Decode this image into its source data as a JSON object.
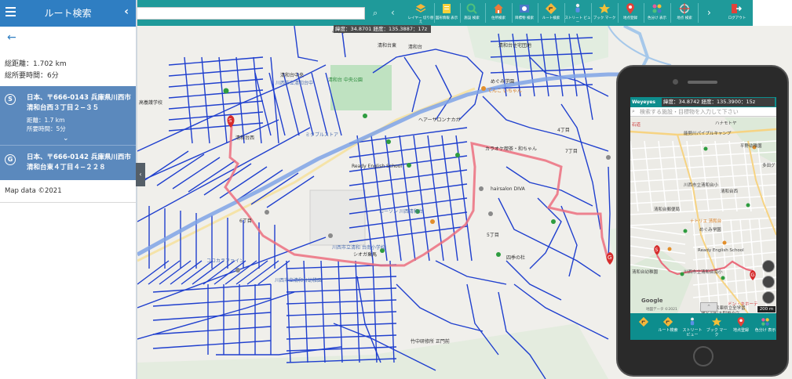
{
  "panel": {
    "title": "ルート検索",
    "summary": {
      "distance": "総距離：1.702 km",
      "duration": "総所要時間：6分"
    },
    "start": {
      "badge": "S",
      "address": "日本、〒666-0143 兵庫県川西市清和台西３丁目２−３５",
      "distance": "距離：1.7 km",
      "duration": "所要時間：5分"
    },
    "goal": {
      "badge": "G",
      "address": "日本、〒666-0142 兵庫県川西市清和台東４丁目４−２２８"
    },
    "map_data": "Map data ©2021"
  },
  "toolbar": {
    "search_placeholder": "",
    "buttons": [
      {
        "label": "レイヤー 切り替え",
        "icon": "layers-icon",
        "color": "#f4b63a"
      },
      {
        "label": "図形情報 表示",
        "icon": "note-icon",
        "color": "#f7d13c"
      },
      {
        "label": "施設 検索",
        "icon": "magnifier-icon",
        "color": "#4fc07c"
      },
      {
        "label": "住所検索",
        "icon": "house-icon",
        "color": "#ee7a3a"
      },
      {
        "label": "目標物 検索",
        "icon": "target-icon",
        "color": "#4b78c9"
      },
      {
        "label": "ルート検索",
        "icon": "route-sign-icon",
        "color": "#f4b63a"
      },
      {
        "label": "ストリート ビュー",
        "icon": "person-icon",
        "color": "#eeeeee"
      },
      {
        "label": "ブック マーク",
        "icon": "star-icon",
        "color": "#f4c037"
      },
      {
        "label": "地点登録",
        "icon": "pin-icon",
        "color": "#e0423a"
      },
      {
        "label": "色分け 表示",
        "icon": "colors-icon",
        "color": "#e85b9c"
      },
      {
        "label": "地点 検索",
        "icon": "crosshair-icon",
        "color": "#666666"
      },
      {
        "label": "ログアウト",
        "icon": "logout-icon",
        "color": "#e0423a"
      }
    ]
  },
  "map": {
    "coords": "緯度：34.8701 経度：135.3887：17z",
    "labels": {
      "park": "清和台 中央公園",
      "area1": "清和台東",
      "area2": "清和台西",
      "facility1": "清和台住宅団地",
      "facility2": "めぐみ学園",
      "school1": "川西市立清和 台南小学校",
      "school2": "川西市立清和台中",
      "shop1": "カラオケ喫茶・和ちゃん",
      "shop2": "ヘアーサロンナカガ",
      "shop3": "hairsalon DIVA",
      "shop4": "Ready English School",
      "chome1": "4丁目",
      "chome2": "5丁目",
      "chome3": "6丁目",
      "chome4": "7丁目",
      "road": "清和台",
      "lawson": "ローソン 川西清和台",
      "shiga": "シオガ乗馬",
      "kindergarten": "川西市立清和台幼稚園",
      "station": "竹中研修所 正門前",
      "estate": "四季の杜",
      "gokk": "ココカラファイン",
      "mitsu": "ミタブルストア",
      "pharmacy": "みやび",
      "gakko": "高養護学校",
      "tenko": "てんこ いちゃん",
      "chuo": "清和台中央"
    }
  },
  "phone": {
    "logo": "Weyeyes",
    "coords": "緯度：34.8742 経度：135.3900：15z",
    "search_placeholder": "検索する施設・目標物を入力して下さい",
    "labels": {
      "shop": "ハナモトヤ",
      "pipe": "能勢川パイプルキャンプ",
      "hirano": "平野幼稚園",
      "tada": "多田グ",
      "school": "川西市立清和台小",
      "school2": "清和台西",
      "kids": "清和台幼稚園",
      "jhs": "川西市立清和台南小",
      "megumi": "めぐみ学園",
      "naite": "ナトリエ 清和台",
      "library": "清和台郵便局",
      "ready": "Ready English School",
      "nogyo": "兵庫県立全学習",
      "nose": "猪名川町大型複合店",
      "attrib": "地図データ ©2021",
      "scale": "200 m",
      "google": "Google",
      "ishi": "石道",
      "don": "ドン・キホーテ"
    },
    "buttons": [
      {
        "label": "",
        "icon": "route-sign-icon",
        "color": "#f4b63a"
      },
      {
        "label": "ルート検索",
        "icon": "route-sign-icon",
        "color": "#f4b63a"
      },
      {
        "label": "ストリート ビュー",
        "icon": "person-icon",
        "color": "#eeeeee"
      },
      {
        "label": "ブック マーク",
        "icon": "star-icon",
        "color": "#f4c037"
      },
      {
        "label": "地点登録",
        "icon": "pin-icon",
        "color": "#e0423a"
      },
      {
        "label": "色分け 表示",
        "icon": "colors-icon",
        "color": "#e85b9c"
      }
    ]
  }
}
